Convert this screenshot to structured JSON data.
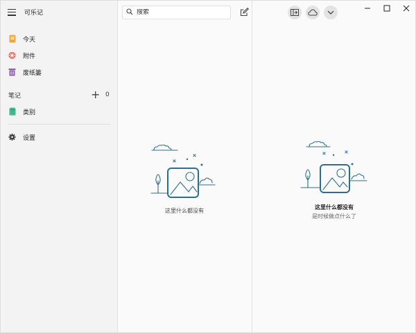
{
  "app": {
    "title": "可乐记"
  },
  "sidebar": {
    "items": [
      {
        "label": "今天",
        "icon": "calendar-today-icon",
        "color": "#f0a23a"
      },
      {
        "label": "附件",
        "icon": "attachment-icon",
        "color": "#e05a4a"
      },
      {
        "label": "废纸篓",
        "icon": "trash-icon",
        "color": "#8b5fb0"
      }
    ],
    "notes_section": {
      "label": "笔记",
      "count": "0"
    },
    "category": {
      "label": "类别",
      "icon": "tag-icon",
      "color": "#3dbb8f"
    },
    "settings": {
      "label": "设置",
      "icon": "gear-icon"
    }
  },
  "search": {
    "placeholder": "搜索"
  },
  "middle_empty": {
    "title": "这里什么都没有"
  },
  "right_empty": {
    "title": "这里什么都没有",
    "subtitle": "是时候做点什么了"
  },
  "colors": {
    "illustration": "#2b6f8e",
    "sidebar_bg": "#f3f3f3",
    "panel_bg": "#fafafa"
  }
}
